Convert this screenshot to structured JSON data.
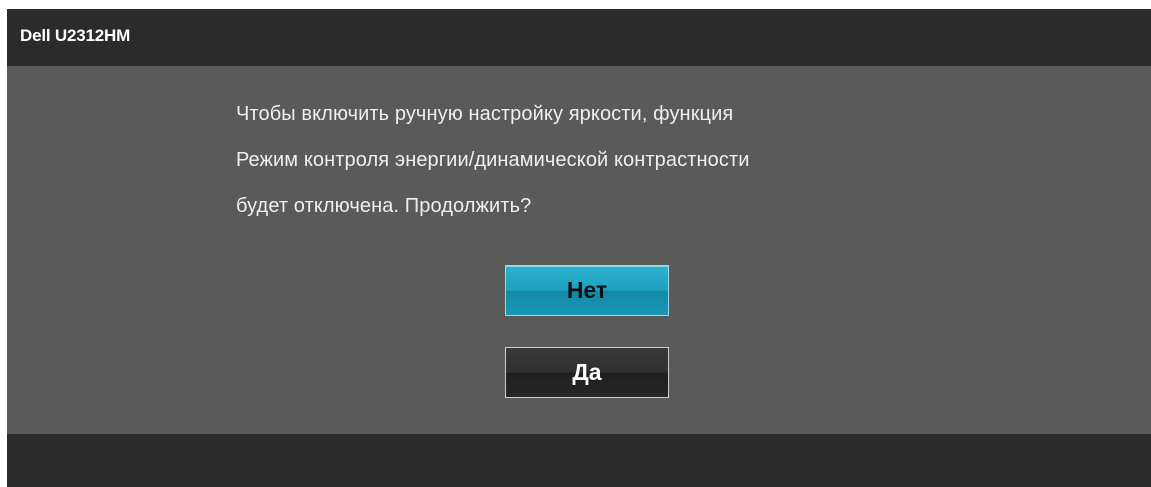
{
  "window": {
    "title": "Dell U2312HM"
  },
  "dialog": {
    "message_lines": [
      "Чтобы включить ручную настройку яркости, функция",
      "Режим контроля энергии/динамической контрастности",
      "будет отключена. Продолжить?"
    ],
    "buttons": {
      "no_label": "Нет",
      "yes_label": "Да"
    }
  },
  "colors": {
    "title_bar": "#2b2b2b",
    "panel": "#5a5a5a",
    "selected_button": "#1ca0bf",
    "unselected_button": "#2a2a2a"
  }
}
